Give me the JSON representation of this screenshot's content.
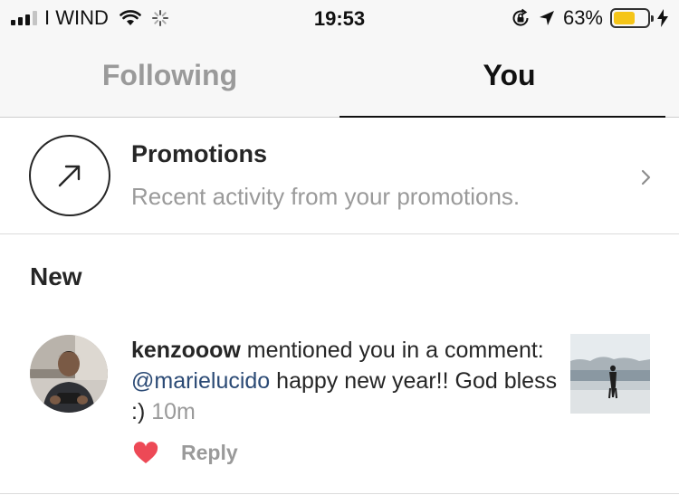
{
  "status_bar": {
    "carrier": "I WIND",
    "time": "19:53",
    "battery_percent": "63%",
    "battery_level": 0.63,
    "icons": [
      "signal-icon",
      "wifi-icon",
      "spinner-icon",
      "rotation-lock-icon",
      "location-arrow-icon",
      "battery-icon",
      "charging-bolt-icon"
    ]
  },
  "tabs": [
    {
      "label": "Following",
      "active": false
    },
    {
      "label": "You",
      "active": true
    }
  ],
  "promotions": {
    "title": "Promotions",
    "subtitle": "Recent activity from your promotions.",
    "icon": "arrow-up-right-icon"
  },
  "section": {
    "heading": "New"
  },
  "notification": {
    "username": "kenzooow",
    "action": " mentioned you in a comment: ",
    "mention": "@marielucido",
    "message": " happy new year!! God bless :) ",
    "time_ago": "10m",
    "reply_label": "Reply"
  },
  "colors": {
    "heart": "#ed4956",
    "battery": "#f5c518",
    "mention": "#2b4a75",
    "muted": "#9a9a9a"
  }
}
